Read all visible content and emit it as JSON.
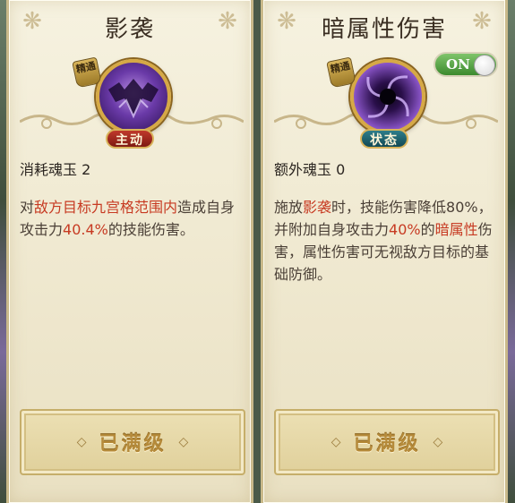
{
  "left_card": {
    "title": "影袭",
    "seal_text": "精通",
    "tag": "主动",
    "cost_label": "消耗魂玉",
    "cost_value": "2",
    "desc": {
      "p1": "对",
      "h1": "敌方目标九宫格范围内",
      "p2": "造成自身攻击力",
      "h2": "40.4%",
      "p3": "的技能伤害。"
    },
    "button_label": "已满级"
  },
  "right_card": {
    "title": "暗属性伤害",
    "seal_text": "精通",
    "tag": "状态",
    "toggle_label": "ON",
    "cost_label": "额外魂玉",
    "cost_value": "0",
    "desc": {
      "p1": "施放",
      "h1": "影袭",
      "p2": "时，技能伤害降低80%，并附加自身攻击力",
      "h2": "40%",
      "p3": "的",
      "h3": "暗属性",
      "p4": "伤害，属性伤害可无视敌方目标的基础防御。"
    },
    "button_label": "已满级"
  },
  "icons": [
    "swirl-ornament-icon",
    "bat-skill-icon",
    "vortex-skill-icon",
    "diamond-icon"
  ],
  "colors": {
    "highlight": "#c73a22",
    "active_tag": "#a52a1e",
    "state_tag": "#1f6470",
    "toggle_on": "#5aa848"
  }
}
